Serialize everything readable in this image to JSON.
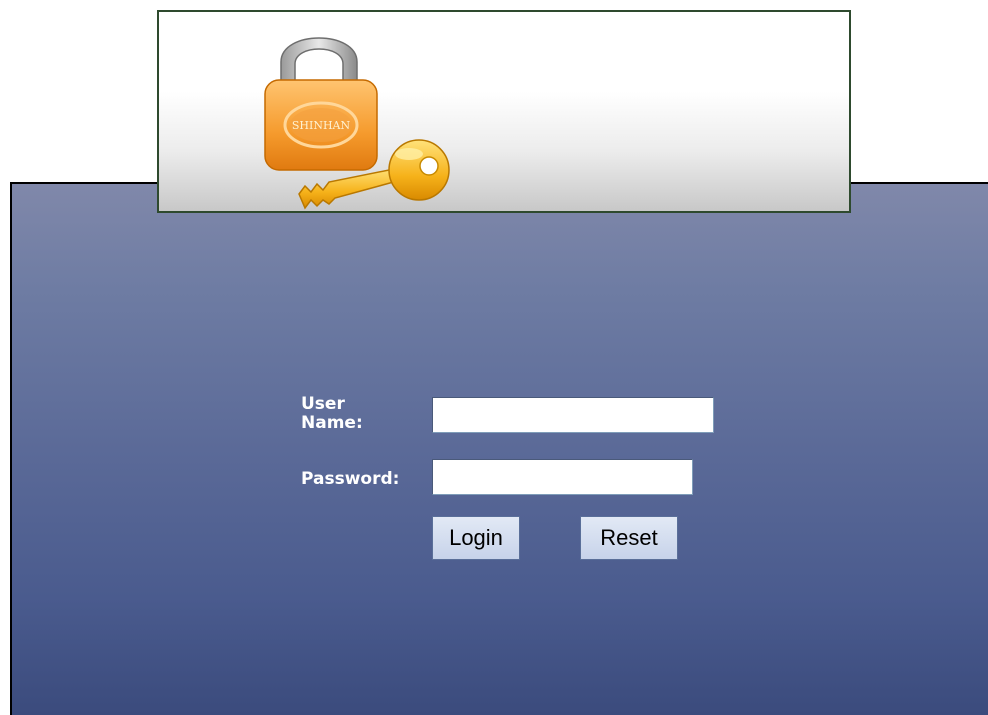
{
  "banner": {
    "icon": "lock-and-key-icon",
    "lock_text": "SHINHAN"
  },
  "form": {
    "username_label": "User Name:",
    "username_value": "",
    "password_label": "Password:",
    "password_value": ""
  },
  "buttons": {
    "login_label": "Login",
    "reset_label": "Reset"
  },
  "colors": {
    "panel_top": "#8088aa",
    "panel_bottom": "#3b4b7d",
    "button_bg": "#c7d3ea",
    "label_text": "#ffffff"
  }
}
